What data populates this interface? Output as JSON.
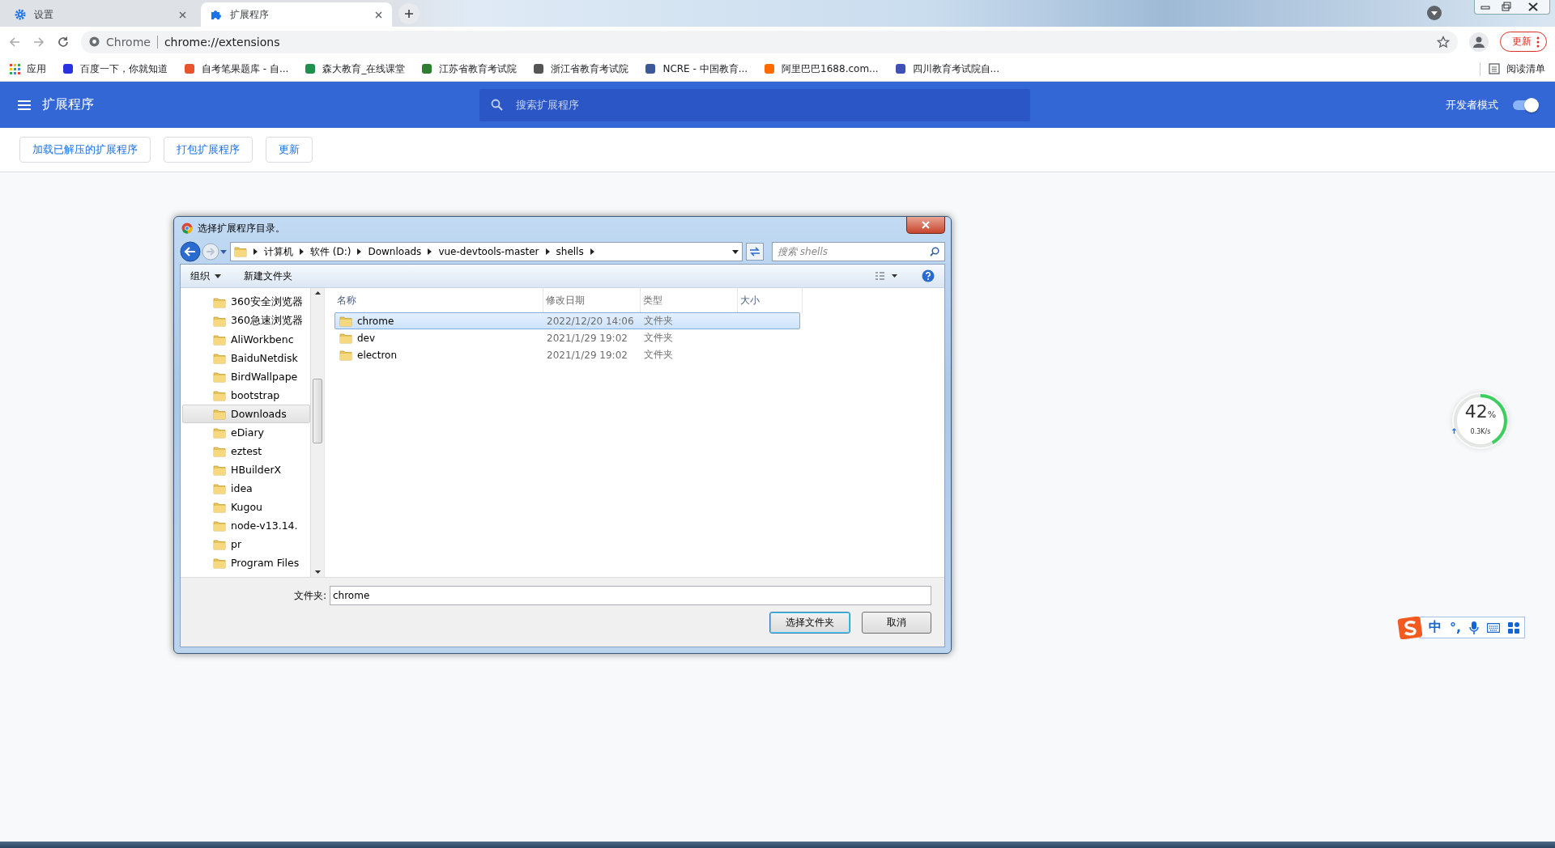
{
  "browser": {
    "tabs": [
      {
        "label": "设置",
        "selected": false
      },
      {
        "label": "扩展程序",
        "selected": true
      }
    ],
    "omnibox": {
      "site_label": "Chrome",
      "url": "chrome://extensions"
    },
    "update_button": "更新",
    "bookmarks": [
      {
        "label": "应用"
      },
      {
        "label": "百度一下，你就知道"
      },
      {
        "label": "自考笔果题库 - 自..."
      },
      {
        "label": "森大教育_在线课堂"
      },
      {
        "label": "江苏省教育考试院"
      },
      {
        "label": "浙江省教育考试院"
      },
      {
        "label": "NCRE - 中国教育..."
      },
      {
        "label": "阿里巴巴1688.com..."
      },
      {
        "label": "四川教育考试院自..."
      }
    ],
    "reading_list": "阅读清单"
  },
  "extensions_page": {
    "title": "扩展程序",
    "search": {
      "placeholder": "搜索扩展程序"
    },
    "developer_mode": {
      "label": "开发者模式",
      "on": true
    },
    "actions": [
      "加载已解压的扩展程序",
      "打包扩展程序",
      "更新"
    ]
  },
  "dialog": {
    "title": "选择扩展程序目录。",
    "breadcrumb": [
      "计算机",
      "软件 (D:)",
      "Downloads",
      "vue-devtools-master",
      "shells"
    ],
    "search": {
      "placeholder": "搜索 shells"
    },
    "commands": [
      "组织",
      "新建文件夹"
    ],
    "nav_items": [
      {
        "label": "360安全浏览器",
        "selected": false
      },
      {
        "label": "360急速浏览器",
        "selected": false
      },
      {
        "label": "AliWorkbenc",
        "selected": false
      },
      {
        "label": "BaiduNetdisk",
        "selected": false
      },
      {
        "label": "BirdWallpape",
        "selected": false
      },
      {
        "label": "bootstrap",
        "selected": false
      },
      {
        "label": "Downloads",
        "selected": true
      },
      {
        "label": "eDiary",
        "selected": false
      },
      {
        "label": "eztest",
        "selected": false
      },
      {
        "label": "HBuilderX",
        "selected": false
      },
      {
        "label": "idea",
        "selected": false
      },
      {
        "label": "Kugou",
        "selected": false
      },
      {
        "label": "node-v13.14.",
        "selected": false
      },
      {
        "label": "pr",
        "selected": false
      },
      {
        "label": "Program Files",
        "selected": false
      }
    ],
    "columns": [
      "名称",
      "修改日期",
      "类型",
      "大小"
    ],
    "files": [
      {
        "name": "chrome",
        "modified": "2022/12/20 14:06",
        "type": "文件夹",
        "selected": true
      },
      {
        "name": "dev",
        "modified": "2021/1/29 19:02",
        "type": "文件夹",
        "selected": false
      },
      {
        "name": "electron",
        "modified": "2021/1/29 19:02",
        "type": "文件夹",
        "selected": false
      }
    ],
    "folder_label": "文件夹:",
    "folder_value": "chrome",
    "buttons": [
      "选择文件夹",
      "取消"
    ]
  },
  "network_widget": {
    "percent": "42",
    "unit": "%",
    "speed": "0.3K/s",
    "level": 0.42
  },
  "ime_bar": {
    "mode": "中",
    "punctuation": "°,"
  }
}
